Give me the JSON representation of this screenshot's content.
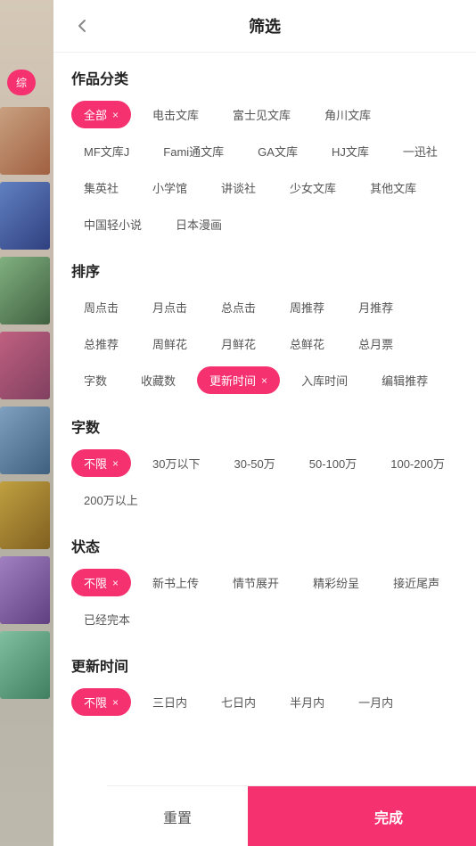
{
  "header": {
    "title": "筛选",
    "back_icon": "‹"
  },
  "sections": {
    "category": {
      "title": "作品分类",
      "tags": [
        {
          "label": "全部",
          "active": true,
          "hasClose": true
        },
        {
          "label": "电击文库",
          "active": false,
          "hasClose": false
        },
        {
          "label": "富士见文库",
          "active": false,
          "hasClose": false
        },
        {
          "label": "角川文库",
          "active": false,
          "hasClose": false
        },
        {
          "label": "MF文库J",
          "active": false,
          "hasClose": false
        },
        {
          "label": "Fami通文库",
          "active": false,
          "hasClose": false
        },
        {
          "label": "GA文库",
          "active": false,
          "hasClose": false
        },
        {
          "label": "HJ文库",
          "active": false,
          "hasClose": false
        },
        {
          "label": "一迅社",
          "active": false,
          "hasClose": false
        },
        {
          "label": "集英社",
          "active": false,
          "hasClose": false
        },
        {
          "label": "小学馆",
          "active": false,
          "hasClose": false
        },
        {
          "label": "讲谈社",
          "active": false,
          "hasClose": false
        },
        {
          "label": "少女文库",
          "active": false,
          "hasClose": false
        },
        {
          "label": "其他文库",
          "active": false,
          "hasClose": false
        },
        {
          "label": "中国轻小说",
          "active": false,
          "hasClose": false
        },
        {
          "label": "日本漫画",
          "active": false,
          "hasClose": false
        }
      ]
    },
    "sort": {
      "title": "排序",
      "tags": [
        {
          "label": "周点击",
          "active": false,
          "hasClose": false
        },
        {
          "label": "月点击",
          "active": false,
          "hasClose": false
        },
        {
          "label": "总点击",
          "active": false,
          "hasClose": false
        },
        {
          "label": "周推荐",
          "active": false,
          "hasClose": false
        },
        {
          "label": "月推荐",
          "active": false,
          "hasClose": false
        },
        {
          "label": "总推荐",
          "active": false,
          "hasClose": false
        },
        {
          "label": "周鲜花",
          "active": false,
          "hasClose": false
        },
        {
          "label": "月鲜花",
          "active": false,
          "hasClose": false
        },
        {
          "label": "总鲜花",
          "active": false,
          "hasClose": false
        },
        {
          "label": "总月票",
          "active": false,
          "hasClose": false
        },
        {
          "label": "字数",
          "active": false,
          "hasClose": false
        },
        {
          "label": "收藏数",
          "active": false,
          "hasClose": false
        },
        {
          "label": "更新时间",
          "active": true,
          "hasClose": true
        },
        {
          "label": "入库时间",
          "active": false,
          "hasClose": false
        },
        {
          "label": "编辑推荐",
          "active": false,
          "hasClose": false
        }
      ]
    },
    "wordcount": {
      "title": "字数",
      "tags": [
        {
          "label": "不限",
          "active": true,
          "hasClose": true
        },
        {
          "label": "30万以下",
          "active": false,
          "hasClose": false
        },
        {
          "label": "30-50万",
          "active": false,
          "hasClose": false
        },
        {
          "label": "50-100万",
          "active": false,
          "hasClose": false
        },
        {
          "label": "100-200万",
          "active": false,
          "hasClose": false
        },
        {
          "label": "200万以上",
          "active": false,
          "hasClose": false
        }
      ]
    },
    "status": {
      "title": "状态",
      "tags": [
        {
          "label": "不限",
          "active": true,
          "hasClose": true
        },
        {
          "label": "新书上传",
          "active": false,
          "hasClose": false
        },
        {
          "label": "情节展开",
          "active": false,
          "hasClose": false
        },
        {
          "label": "精彩纷呈",
          "active": false,
          "hasClose": false
        },
        {
          "label": "接近尾声",
          "active": false,
          "hasClose": false
        },
        {
          "label": "已经完本",
          "active": false,
          "hasClose": false
        }
      ]
    },
    "update_time": {
      "title": "更新时间",
      "tags": [
        {
          "label": "不限",
          "active": true,
          "hasClose": true
        },
        {
          "label": "三日内",
          "active": false,
          "hasClose": false
        },
        {
          "label": "七日内",
          "active": false,
          "hasClose": false
        },
        {
          "label": "半月内",
          "active": false,
          "hasClose": false
        },
        {
          "label": "一月内",
          "active": false,
          "hasClose": false
        }
      ]
    }
  },
  "footer": {
    "reset_label": "重置",
    "confirm_label": "完成"
  },
  "left_pill": "综",
  "close_symbol": "×"
}
